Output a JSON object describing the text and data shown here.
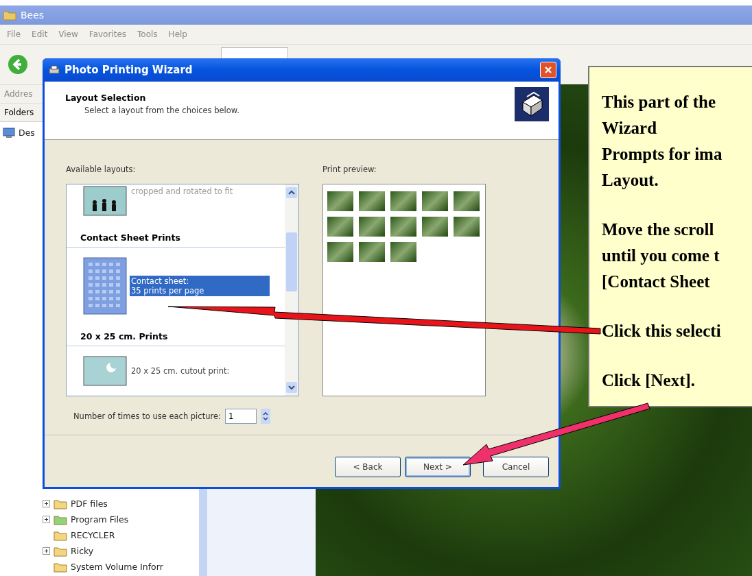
{
  "window": {
    "title": "Bees"
  },
  "menu": [
    "File",
    "Edit",
    "View",
    "Favorites",
    "Tools",
    "Help"
  ],
  "address_label": "Addres",
  "folders_pane": {
    "title": "Folders",
    "top_item": "Des",
    "items": [
      {
        "label": "PDF files",
        "expandable": true,
        "color": "#f2d780"
      },
      {
        "label": "Program Files",
        "expandable": true,
        "color": "#8fd47a"
      },
      {
        "label": "RECYCLER",
        "expandable": false,
        "color": "#f2d780"
      },
      {
        "label": "Ricky",
        "expandable": true,
        "color": "#f2d780"
      },
      {
        "label": "System Volume Inforr",
        "expandable": false,
        "color": "#f2d780"
      }
    ]
  },
  "dialog": {
    "title": "Photo Printing Wizard",
    "heading": "Layout Selection",
    "subheading": "Select a layout from the choices below.",
    "layouts_label": "Available layouts:",
    "layouts": [
      {
        "kind": "people_item",
        "text": "cropped and rotated to fit",
        "selected": false
      },
      {
        "kind": "group",
        "text": "Contact Sheet Prints"
      },
      {
        "kind": "sheet_item",
        "text": "Contact sheet:\n35 prints per page",
        "selected": true
      },
      {
        "kind": "group",
        "text": "20 x 25 cm. Prints"
      },
      {
        "kind": "print_item",
        "text": "20 x 25 cm. cutout print:",
        "selected": false
      }
    ],
    "preview_label": "Print preview:",
    "preview_photos": [
      {
        "kind": "photo"
      },
      {
        "kind": "photo"
      },
      {
        "kind": "photo"
      },
      {
        "kind": "photo"
      },
      {
        "kind": "photo"
      },
      {
        "kind": "photo"
      },
      {
        "kind": "photo"
      },
      {
        "kind": "photo"
      },
      {
        "kind": "photo"
      },
      {
        "kind": "photo"
      },
      {
        "kind": "photo"
      },
      {
        "kind": "photo"
      },
      {
        "kind": "photo"
      }
    ],
    "copies_label": "Number of times to use each picture:",
    "copies_value": "1",
    "buttons": [
      {
        "label": "< Back",
        "default": false
      },
      {
        "label": "Next >",
        "default": true
      },
      {
        "label": "Cancel",
        "default": false
      }
    ]
  },
  "callout": {
    "paragraphs": [
      [
        "This part of the",
        "Wizard",
        "Prompts for ima",
        "Layout."
      ],
      [
        "Move the scroll",
        "until you come t",
        "[Contact Sheet"
      ],
      [
        "Click this selecti"
      ],
      [
        "Click [Next]."
      ]
    ]
  }
}
